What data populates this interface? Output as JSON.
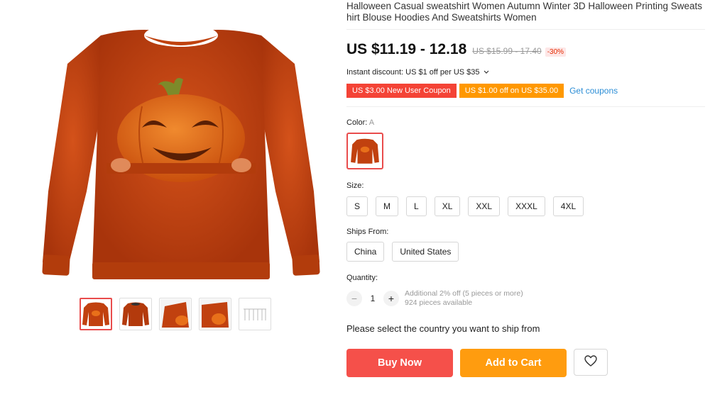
{
  "product": {
    "title": "Halloween Casual sweatshirt Women Autumn Winter 3D Halloween Printing Sweatshirt Blouse Hoodies And Sweatshirts Women"
  },
  "price": {
    "current": "US $11.19 - 12.18",
    "original": "US $15.99 - 17.40",
    "discount": "-30%"
  },
  "instant_discount": {
    "text": "Instant discount: US $1 off per US $35",
    "icon": "chevron-down-icon"
  },
  "coupons": {
    "items": [
      {
        "text": "US $3.00 New User Coupon",
        "color": "#f44336"
      },
      {
        "text": "US $1.00 off on US $35.00",
        "color": "#ff9800"
      }
    ],
    "get_label": "Get coupons"
  },
  "color": {
    "label": "Color:",
    "selected": "A"
  },
  "size": {
    "label": "Size:",
    "options": [
      "S",
      "M",
      "L",
      "XL",
      "XXL",
      "XXXL",
      "4XL"
    ]
  },
  "ships_from": {
    "label": "Ships From:",
    "options": [
      "China",
      "United States"
    ]
  },
  "quantity": {
    "label": "Quantity:",
    "value": "1",
    "minus": "−",
    "plus": "+",
    "additional": "Additional 2% off (5 pieces or more)",
    "available": "924 pieces available"
  },
  "ship_message": "Please select the country you want to ship from",
  "buttons": {
    "buy_now": "Buy Now",
    "add_to_cart": "Add to Cart",
    "wishlist_icon": "heart-icon"
  },
  "gallery": {
    "thumbnail_count": 5,
    "selected_index": 0
  },
  "colors": {
    "accent": "#f5504a",
    "cart": "#ff9c0f",
    "sweatshirt": "#c1410f",
    "pumpkin": "#e8701a"
  }
}
